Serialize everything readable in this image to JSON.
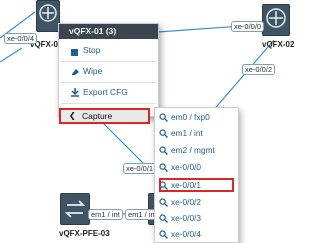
{
  "topology": {
    "nodes": [
      {
        "id": "vqfx01",
        "label": "vQFX-01"
      },
      {
        "id": "vqfx02",
        "label": "vQFX-02"
      },
      {
        "id": "vqfxpfe03",
        "label": "vQFX-PFE-03"
      }
    ],
    "links": [
      {
        "label": "xe-0/0/4"
      },
      {
        "label": "xe-0/0/0"
      },
      {
        "label": "xe-0/0/2"
      },
      {
        "label": "xe-0/0/1"
      },
      {
        "label": "em1 / int"
      },
      {
        "label": "em1 / int"
      }
    ]
  },
  "context_menu": {
    "title": "vQFX-01 (3)",
    "items": [
      {
        "label": "Stop",
        "icon": "stop-icon"
      },
      {
        "label": "Wipe",
        "icon": "wipe-icon"
      },
      {
        "label": "Export CFG",
        "icon": "export-icon"
      }
    ],
    "capture": {
      "label": "Capture",
      "icon": "chevron-left-icon"
    }
  },
  "capture_submenu": {
    "items": [
      {
        "label": "em0 / fxp0",
        "icon": "search-icon"
      },
      {
        "label": "em1 / int",
        "icon": "search-icon"
      },
      {
        "label": "em2 / mgmt",
        "icon": "search-icon"
      },
      {
        "label": "xe-0/0/0",
        "icon": "search-icon"
      },
      {
        "label": "xe-0/0/1",
        "icon": "search-icon",
        "highlighted": true
      },
      {
        "label": "xe-0/0/2",
        "icon": "search-icon"
      },
      {
        "label": "xe-0/0/3",
        "icon": "search-icon"
      },
      {
        "label": "xe-0/0/4",
        "icon": "search-icon"
      }
    ]
  },
  "colors": {
    "menu_header": "#3a4550",
    "menu_text": "#1f5f8f",
    "highlight_border": "#d62828",
    "link_line": "#3b8fd1"
  }
}
